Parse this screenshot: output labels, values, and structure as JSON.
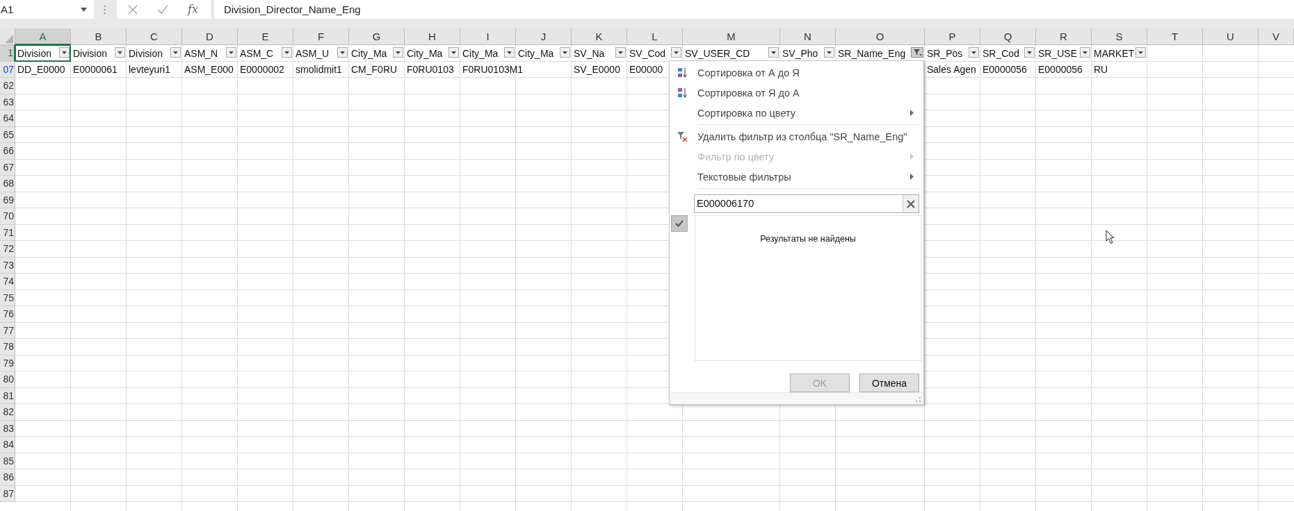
{
  "name_box": {
    "value": "A1"
  },
  "formula_bar": {
    "fx": "fx",
    "value": "Division_Director_Name_Eng"
  },
  "columns": [
    {
      "letter": "A",
      "selected": true,
      "has_filter": true,
      "filtered": false
    },
    {
      "letter": "B",
      "selected": false,
      "has_filter": true,
      "filtered": false
    },
    {
      "letter": "C",
      "selected": false,
      "has_filter": true,
      "filtered": false
    },
    {
      "letter": "D",
      "selected": false,
      "has_filter": true,
      "filtered": false
    },
    {
      "letter": "E",
      "selected": false,
      "has_filter": true,
      "filtered": false
    },
    {
      "letter": "F",
      "selected": false,
      "has_filter": true,
      "filtered": false
    },
    {
      "letter": "G",
      "selected": false,
      "has_filter": true,
      "filtered": false
    },
    {
      "letter": "H",
      "selected": false,
      "has_filter": true,
      "filtered": false
    },
    {
      "letter": "I",
      "selected": false,
      "has_filter": true,
      "filtered": false
    },
    {
      "letter": "J",
      "selected": false,
      "has_filter": true,
      "filtered": false
    },
    {
      "letter": "K",
      "selected": false,
      "has_filter": true,
      "filtered": false
    },
    {
      "letter": "L",
      "selected": false,
      "has_filter": true,
      "filtered": false
    },
    {
      "letter": "M",
      "selected": false,
      "has_filter": true,
      "filtered": false
    },
    {
      "letter": "N",
      "selected": false,
      "has_filter": true,
      "filtered": false
    },
    {
      "letter": "O",
      "selected": false,
      "has_filter": true,
      "filtered": true
    },
    {
      "letter": "P",
      "selected": false,
      "has_filter": true,
      "filtered": false
    },
    {
      "letter": "Q",
      "selected": false,
      "has_filter": true,
      "filtered": false
    },
    {
      "letter": "R",
      "selected": false,
      "has_filter": true,
      "filtered": false
    },
    {
      "letter": "S",
      "selected": false,
      "has_filter": true,
      "filtered": false
    },
    {
      "letter": "T",
      "selected": false,
      "has_filter": false
    },
    {
      "letter": "U",
      "selected": false,
      "has_filter": false
    },
    {
      "letter": "V",
      "selected": false,
      "has_filter": false
    }
  ],
  "rows": [
    {
      "number": "1",
      "selected": true,
      "filtered": false,
      "cells": {
        "A": "Division",
        "B": "Division",
        "C": "Division",
        "D": "ASM_N",
        "E": "ASM_C",
        "F": "ASM_U",
        "G": "City_Ma",
        "H": "City_Ma",
        "I": "City_Ma",
        "J": "City_Ma",
        "K": "SV_Na",
        "L": "SV_Cod",
        "M": "SV_USER_CD",
        "N": "SV_Pho",
        "O": "SR_Name_Eng",
        "P": "SR_Pos",
        "Q": "SR_Cod",
        "R": "SR_USE",
        "S": "MARKET"
      }
    },
    {
      "number": "07",
      "selected": false,
      "filtered": true,
      "cells": {
        "A": "DD_E0000",
        "B": "E0000061",
        "C": "levteyuri1",
        "D": "ASM_E000",
        "E": "E0000002",
        "F": "smolidmit1",
        "G": "CM_F0RU",
        "H": "F0RU0103",
        "I": "F0RU0103M1",
        "K": "SV_E0000",
        "L": "E00000",
        "P": "Sales Agen",
        "Q": "E0000056",
        "R": "E0000056",
        "S": "RU"
      }
    },
    {
      "number": "62",
      "selected": false,
      "filtered": false
    },
    {
      "number": "63",
      "selected": false,
      "filtered": false
    },
    {
      "number": "64",
      "selected": false,
      "filtered": false
    },
    {
      "number": "65",
      "selected": false,
      "filtered": false
    },
    {
      "number": "66",
      "selected": false,
      "filtered": false
    },
    {
      "number": "67",
      "selected": false,
      "filtered": false
    },
    {
      "number": "68",
      "selected": false,
      "filtered": false
    },
    {
      "number": "69",
      "selected": false,
      "filtered": false
    },
    {
      "number": "70",
      "selected": false,
      "filtered": false
    },
    {
      "number": "71",
      "selected": false,
      "filtered": false
    },
    {
      "number": "72",
      "selected": false,
      "filtered": false
    },
    {
      "number": "73",
      "selected": false,
      "filtered": false
    },
    {
      "number": "74",
      "selected": false,
      "filtered": false
    },
    {
      "number": "75",
      "selected": false,
      "filtered": false
    },
    {
      "number": "76",
      "selected": false,
      "filtered": false
    },
    {
      "number": "77",
      "selected": false,
      "filtered": false
    },
    {
      "number": "78",
      "selected": false,
      "filtered": false
    },
    {
      "number": "79",
      "selected": false,
      "filtered": false
    },
    {
      "number": "80",
      "selected": false,
      "filtered": false
    },
    {
      "number": "81",
      "selected": false,
      "filtered": false
    },
    {
      "number": "82",
      "selected": false,
      "filtered": false
    },
    {
      "number": "83",
      "selected": false,
      "filtered": false
    },
    {
      "number": "84",
      "selected": false,
      "filtered": false
    },
    {
      "number": "85",
      "selected": false,
      "filtered": false
    },
    {
      "number": "86",
      "selected": false,
      "filtered": false
    },
    {
      "number": "87",
      "selected": false,
      "filtered": false
    }
  ],
  "filter_menu": {
    "items": [
      {
        "kind": "sort-asc",
        "label": "Сортировка от А до Я",
        "disabled": false,
        "submenu": false
      },
      {
        "kind": "sort-desc",
        "label": "Сортировка от Я до А",
        "disabled": false,
        "submenu": false
      },
      {
        "kind": "plain",
        "label": "Сортировка по цвету",
        "disabled": false,
        "submenu": true
      },
      {
        "kind": "separator"
      },
      {
        "kind": "clear-filter",
        "label": "Удалить фильтр из столбца \"SR_Name_Eng\"",
        "disabled": false,
        "submenu": false
      },
      {
        "kind": "plain",
        "label": "Фильтр по цвету",
        "disabled": true,
        "submenu": true
      },
      {
        "kind": "plain",
        "label": "Текстовые фильтры",
        "disabled": false,
        "submenu": true
      },
      {
        "kind": "separator"
      }
    ],
    "search": {
      "value": "E000006170"
    },
    "select_all": {
      "checked": true
    },
    "list": {
      "message": "Результаты не найдены"
    },
    "buttons": [
      {
        "label": "OK",
        "disabled": true
      },
      {
        "label": "Отмена",
        "disabled": false
      }
    ]
  }
}
